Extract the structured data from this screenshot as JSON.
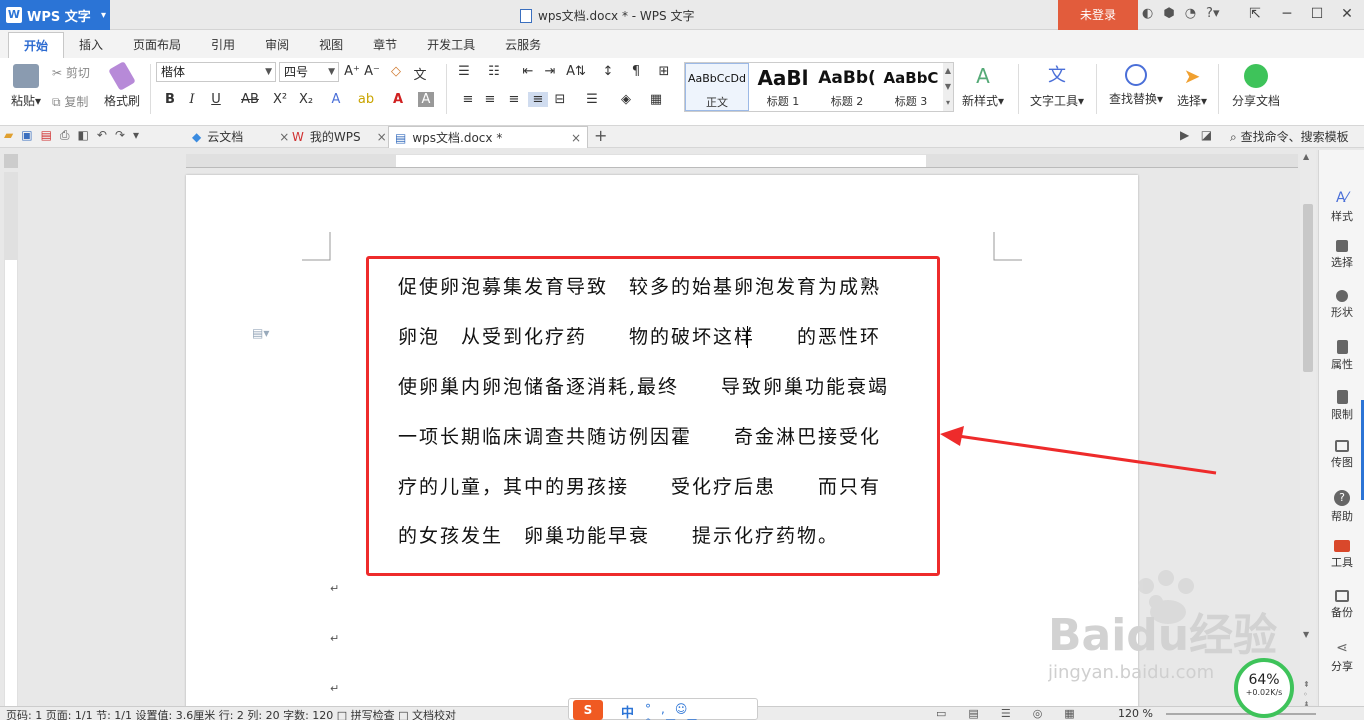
{
  "window": {
    "app_name": "WPS 文字",
    "title": "wps文档.docx * - WPS 文字",
    "login": "未登录"
  },
  "menu": {
    "tabs": [
      "开始",
      "插入",
      "页面布局",
      "引用",
      "审阅",
      "视图",
      "章节",
      "开发工具",
      "云服务"
    ]
  },
  "ribbon": {
    "paste": "粘贴",
    "cut": "剪切",
    "copy": "复制",
    "format_painter": "格式刷",
    "font_name": "楷体",
    "font_size": "四号",
    "styles": [
      {
        "preview": "AaBbCcDd",
        "label": "正文"
      },
      {
        "preview": "AaBl",
        "label": "标题 1"
      },
      {
        "preview": "AaBb(",
        "label": "标题 2"
      },
      {
        "preview": "AaBbC",
        "label": "标题 3"
      }
    ],
    "new_style": "新样式",
    "text_tools": "文字工具",
    "find_replace": "查找替换",
    "select": "选择",
    "share_doc": "分享文档"
  },
  "doc_tabs": {
    "cloud": "云文档",
    "mywps": "我的WPS",
    "active": "wps文档.docx *",
    "search_placeholder": "查找命令、搜索模板"
  },
  "document": {
    "lines": [
      "促使卵泡募集发育导致　较多的始基卵泡发育为成熟",
      "卵泡　从受到化疗药　　物的破坏这样　　的恶性环",
      "使卵巢内卵泡储备逐消耗,最终　　导致卵巢功能衰竭",
      "一项长期临床调查共随访例因霍　　奇金淋巴接受化",
      "疗的儿童，其中的男孩接　　受化疗后患　　而只有",
      "的女孩发生　卵巢功能早衰　　提示化疗药物。"
    ],
    "paragraph_mark": "↵"
  },
  "sidebar": {
    "items": [
      "样式",
      "选择",
      "形状",
      "属性",
      "限制",
      "传图",
      "帮助",
      "工具",
      "备份",
      "分享"
    ]
  },
  "status": {
    "text": "页码: 1  页面: 1/1  节: 1/1  设置值: 3.6厘米  行: 2  列: 20  字数: 120  □ 拼写检查  □ 文档校对",
    "zoom": "120 %"
  },
  "ime": {
    "label": "中"
  },
  "speed": {
    "percent": "64%",
    "rate": "+0.02K/s"
  },
  "watermark": {
    "brand": "Baidu经验",
    "url": "jingyan.baidu.com"
  },
  "colors": {
    "accent": "#2b74d6",
    "login_bg": "#e25c3c",
    "highlight_box": "#ee2b2b",
    "arrow": "#ee2b2b"
  }
}
